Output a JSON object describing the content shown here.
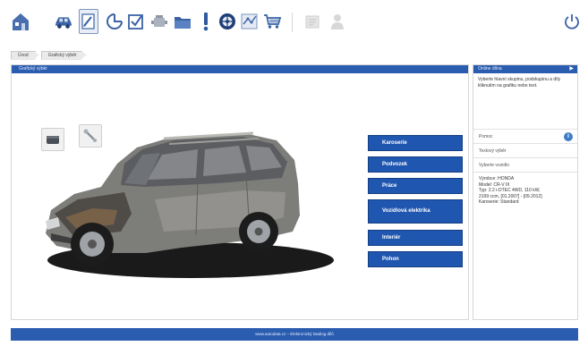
{
  "toolbar": {
    "icons": [
      {
        "name": "home-icon"
      },
      {
        "name": "car-icon"
      },
      {
        "name": "graphic-search-icon",
        "active": true
      },
      {
        "name": "clock-icon"
      },
      {
        "name": "checklist-icon"
      },
      {
        "name": "engine-icon"
      },
      {
        "name": "folder-icon"
      },
      {
        "name": "warning-icon"
      },
      {
        "name": "wheel-icon"
      },
      {
        "name": "diagram-icon"
      },
      {
        "name": "cart-icon"
      },
      {
        "name": "document-icon",
        "disabled": true
      },
      {
        "name": "user-icon",
        "disabled": true
      },
      {
        "name": "power-icon"
      }
    ]
  },
  "breadcrumb": {
    "items": [
      "Úvod",
      "Grafický výběr"
    ]
  },
  "main": {
    "header_title": "Grafický výběr",
    "categories": [
      "Karoserie",
      "Podvozek",
      "Práce",
      "Vozidlová elektrika",
      "Interiér",
      "Pohon"
    ]
  },
  "sidebar": {
    "header_title": "Online dílna",
    "help_text": "Vyberte hlavní skupinu, podskupinu a díly kliknutím na grafiku nebo text.",
    "rows": [
      "Pomoc",
      "Textový výběr",
      "Vyberte vozidlo"
    ],
    "vehicle_info": [
      "Výrobce: HONDA",
      "Model: CR-V III",
      "Typ: 2.2 i-DTEC 4WD, 110 kW,",
      "2199 ccm, [01.2007] - [09.2012]",
      "Karoserie: Standard"
    ]
  },
  "footer": {
    "text": "www.autodata.cz – Elektronický katalog dílů"
  },
  "colors": {
    "accent_blue": "#2a5db0",
    "button_blue": "#1f56b0",
    "icon_blue": "#3a63a6"
  }
}
